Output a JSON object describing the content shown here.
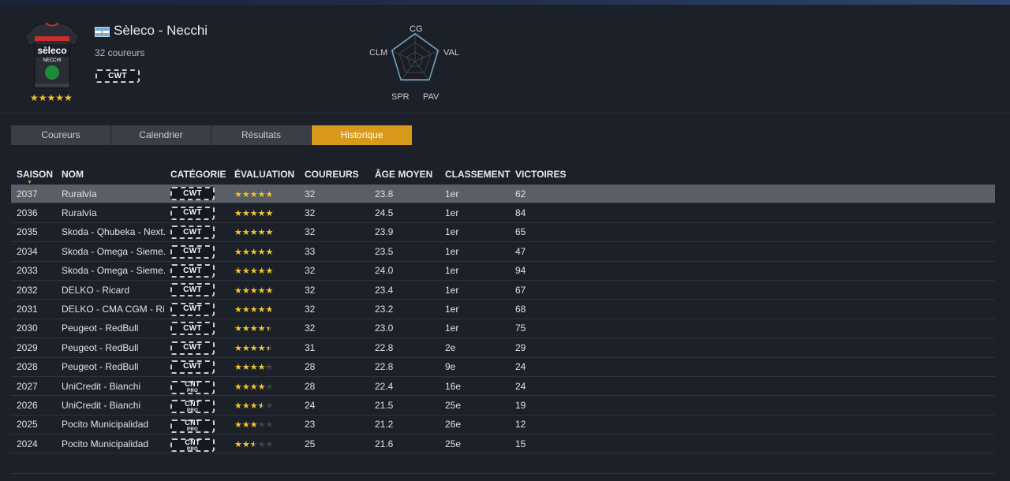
{
  "team": {
    "name": "Sèleco - Necchi",
    "riders_count": "32 coureurs",
    "category": "CWT",
    "stars": "★★★★★",
    "jersey_text": "sèleco",
    "jersey_sub": "NECCHI",
    "flag": "argentina-flag"
  },
  "radar": {
    "labels": {
      "cg": "CG",
      "val": "VAL",
      "pav": "PAV",
      "spr": "SPR",
      "clm": "CLM"
    }
  },
  "tabs": [
    {
      "label": "Coureurs",
      "active": false
    },
    {
      "label": "Calendrier",
      "active": false
    },
    {
      "label": "Résultats",
      "active": false
    },
    {
      "label": "Historique",
      "active": true
    }
  ],
  "table": {
    "headers": {
      "season": "SAISON",
      "name": "NOM",
      "category": "CATÉGORIE",
      "rating": "ÉVALUATION",
      "riders": "COUREURS",
      "avg_age": "ÂGE MOYEN",
      "ranking": "CLASSEMENT",
      "wins": "VICTOIRES"
    },
    "rows": [
      {
        "season": "2037",
        "name": "Ruralvía",
        "cat": "CWT",
        "cat_sub": "",
        "rating": 0.95,
        "riders": "32",
        "age": "23.8",
        "rank": "1er",
        "wins": "62",
        "selected": true
      },
      {
        "season": "2036",
        "name": "Ruralvía",
        "cat": "CWT",
        "cat_sub": "",
        "rating": 1.0,
        "riders": "32",
        "age": "24.5",
        "rank": "1er",
        "wins": "84"
      },
      {
        "season": "2035",
        "name": "Skoda - Qhubeka - Next..",
        "cat": "CWT",
        "cat_sub": "",
        "rating": 1.0,
        "riders": "32",
        "age": "23.9",
        "rank": "1er",
        "wins": "65"
      },
      {
        "season": "2034",
        "name": "Skoda - Omega - Sieme..",
        "cat": "CWT",
        "cat_sub": "",
        "rating": 1.0,
        "riders": "33",
        "age": "23.5",
        "rank": "1er",
        "wins": "47"
      },
      {
        "season": "2033",
        "name": "Skoda - Omega - Sieme..",
        "cat": "CWT",
        "cat_sub": "",
        "rating": 1.0,
        "riders": "32",
        "age": "24.0",
        "rank": "1er",
        "wins": "94"
      },
      {
        "season": "2032",
        "name": "DELKO - Ricard",
        "cat": "CWT",
        "cat_sub": "",
        "rating": 1.0,
        "riders": "32",
        "age": "23.4",
        "rank": "1er",
        "wins": "67"
      },
      {
        "season": "2031",
        "name": "DELKO - CMA CGM - Ric..",
        "cat": "CWT",
        "cat_sub": "",
        "rating": 0.95,
        "riders": "32",
        "age": "23.2",
        "rank": "1er",
        "wins": "68"
      },
      {
        "season": "2030",
        "name": "Peugeot - RedBull",
        "cat": "CWT",
        "cat_sub": "",
        "rating": 0.9,
        "riders": "32",
        "age": "23.0",
        "rank": "1er",
        "wins": "75"
      },
      {
        "season": "2029",
        "name": "Peugeot - RedBull",
        "cat": "CWT",
        "cat_sub": "",
        "rating": 0.9,
        "riders": "31",
        "age": "22.8",
        "rank": "2e",
        "wins": "29"
      },
      {
        "season": "2028",
        "name": "Peugeot - RedBull",
        "cat": "CWT",
        "cat_sub": "",
        "rating": 0.85,
        "riders": "28",
        "age": "22.8",
        "rank": "9e",
        "wins": "24"
      },
      {
        "season": "2027",
        "name": "UniCredit - Bianchi",
        "cat": "CNT",
        "cat_sub": "PRO",
        "rating": 0.8,
        "riders": "28",
        "age": "22.4",
        "rank": "16e",
        "wins": "24"
      },
      {
        "season": "2026",
        "name": "UniCredit - Bianchi",
        "cat": "CNT",
        "cat_sub": "PRO",
        "rating": 0.7,
        "riders": "24",
        "age": "21.5",
        "rank": "25e",
        "wins": "19"
      },
      {
        "season": "2025",
        "name": "Pocito Municipalidad",
        "cat": "CNT",
        "cat_sub": "PRO",
        "rating": 0.6,
        "riders": "23",
        "age": "21.2",
        "rank": "26e",
        "wins": "12"
      },
      {
        "season": "2024",
        "name": "Pocito Municipalidad",
        "cat": "CNT",
        "cat_sub": "PRO",
        "rating": 0.5,
        "riders": "25",
        "age": "21.6",
        "rank": "25e",
        "wins": "15"
      }
    ]
  },
  "colors": {
    "accent": "#d99a1b",
    "star": "#f3c623",
    "background": "#1c2029",
    "selected_row": "#5a5e66"
  }
}
